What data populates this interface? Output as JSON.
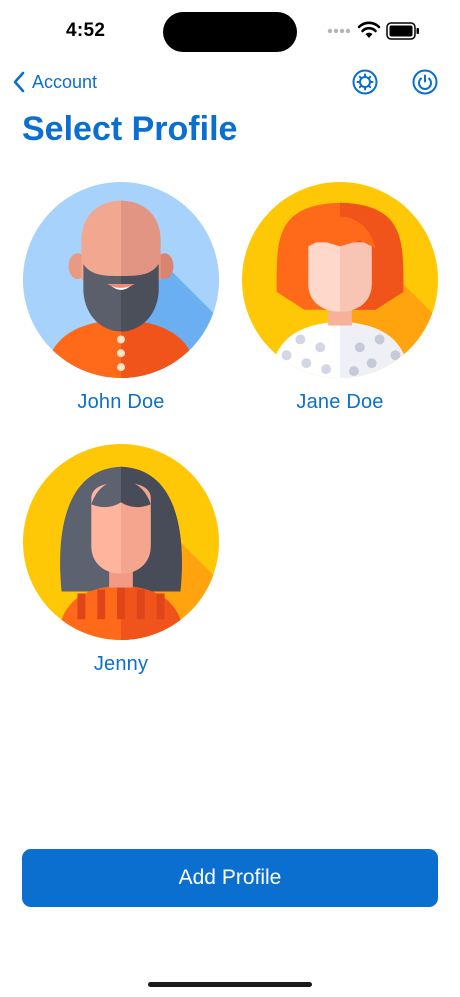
{
  "status_bar": {
    "time": "4:52"
  },
  "nav": {
    "back_label": "Account"
  },
  "page_title": "Select Profile",
  "profiles": [
    {
      "name": "John Doe"
    },
    {
      "name": "Jane Doe"
    },
    {
      "name": "Jenny"
    }
  ],
  "add_button_label": "Add Profile",
  "icons": {
    "back": "chevron-left-icon",
    "settings": "gear-icon",
    "power": "power-icon",
    "wifi": "wifi-icon",
    "battery": "battery-icon",
    "cellular": "cellular-signal-icon"
  },
  "colors": {
    "accent": "#0B6FCF",
    "background": "#FFFFFF"
  }
}
